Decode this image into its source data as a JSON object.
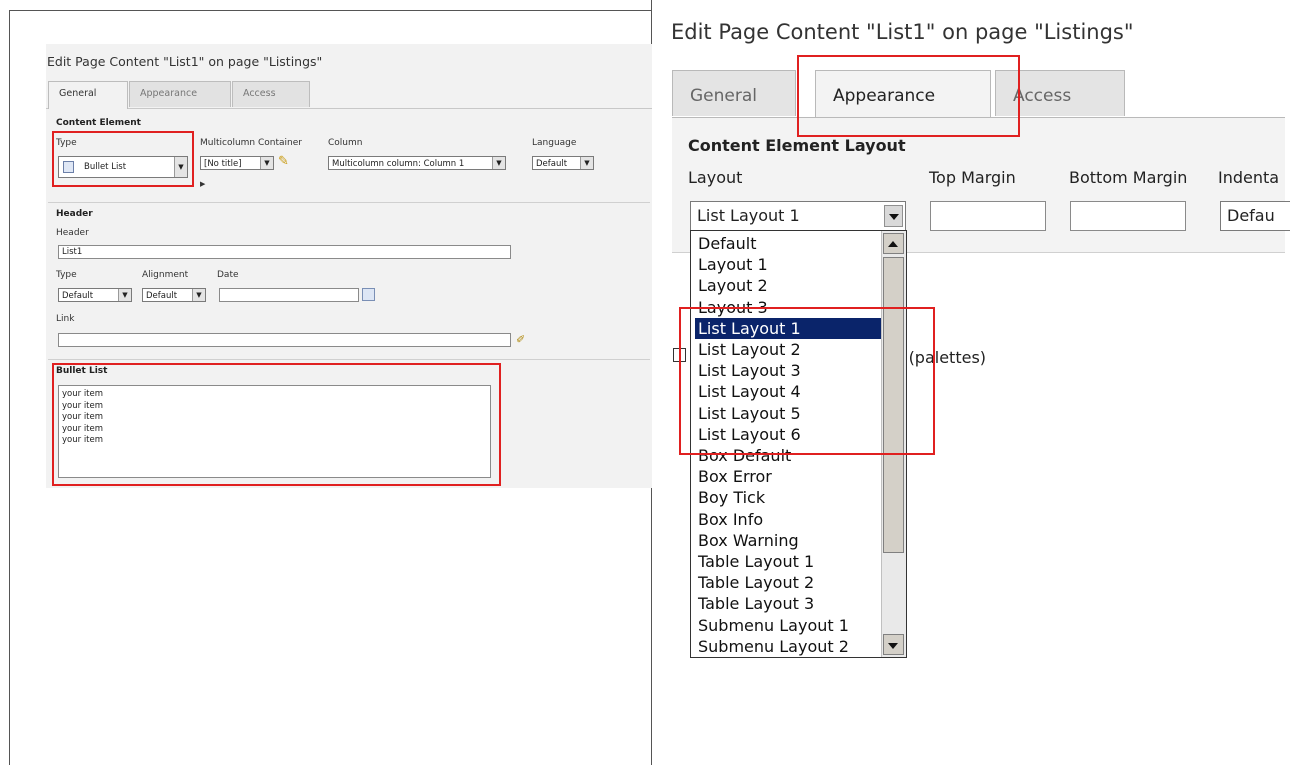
{
  "left": {
    "title": "Edit Page Content \"List1\" on page \"Listings\"",
    "tabs": [
      {
        "label": "General",
        "active": true
      },
      {
        "label": "Appearance",
        "active": false
      },
      {
        "label": "Access",
        "active": false
      }
    ],
    "content_element": {
      "heading": "Content Element",
      "type_label": "Type",
      "type_value": "Bullet List",
      "multicolumn_label": "Multicolumn Container",
      "multicolumn_value": "[No title]",
      "column_label": "Column",
      "column_value": "Multicolumn column: Column 1",
      "language_label": "Language",
      "language_value": "Default"
    },
    "header": {
      "heading": "Header",
      "header_label": "Header",
      "header_value": "List1",
      "type_label": "Type",
      "type_value": "Default",
      "alignment_label": "Alignment",
      "alignment_value": "Default",
      "date_label": "Date",
      "date_value": "",
      "link_label": "Link",
      "link_value": ""
    },
    "bullet_list": {
      "heading": "Bullet List",
      "text": "your item\nyour item\nyour item\nyour item\nyour item"
    }
  },
  "right": {
    "title": "Edit Page Content \"List1\" on page \"Listings\"",
    "tabs": [
      {
        "label": "General",
        "active": false
      },
      {
        "label": "Appearance",
        "active": true
      },
      {
        "label": "Access",
        "active": false
      }
    ],
    "section_heading": "Content Element Layout",
    "layout_label": "Layout",
    "layout_value": "List Layout 1",
    "top_margin_label": "Top Margin",
    "bottom_margin_label": "Bottom Margin",
    "indentation_label": "Indenta",
    "indentation_value": "Defau",
    "palettes_text": "ns (palettes)",
    "layout_options": [
      "Default",
      "Layout 1",
      "Layout 2",
      "Layout 3",
      "List Layout 1",
      "List Layout 2",
      "List Layout 3",
      "List Layout 4",
      "List Layout 5",
      "List Layout 6",
      "Box Default",
      "Box Error",
      "Boy Tick",
      "Box Info",
      "Box Warning",
      "Table Layout 1",
      "Table Layout 2",
      "Table Layout 3",
      "Submenu Layout 1",
      "Submenu Layout 2"
    ],
    "selected_option": "List Layout 1"
  },
  "colors": {
    "highlight_box": "#e02020",
    "selected_item_bg": "#0a246a",
    "panel_bg": "#f2f2f2"
  }
}
